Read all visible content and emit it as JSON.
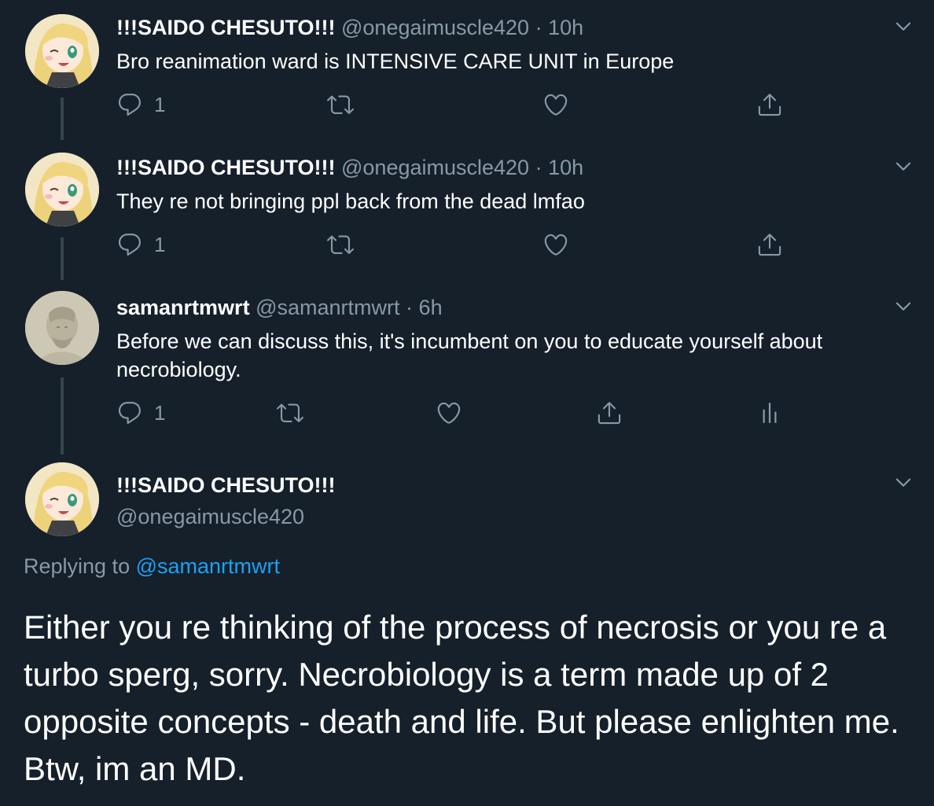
{
  "tweets": [
    {
      "name": "!!!SAIDO CHESUTO!!!",
      "handle": "@onegaimuscle420",
      "separator": "·",
      "time": "10h",
      "text": "Bro reanimation ward is INTENSIVE CARE UNIT in Europe",
      "reply_count": "1"
    },
    {
      "name": "!!!SAIDO CHESUTO!!!",
      "handle": "@onegaimuscle420",
      "separator": "·",
      "time": "10h",
      "text": "They re not bringing ppl back from the dead lmfao",
      "reply_count": "1"
    },
    {
      "name": "samanrtmwrt",
      "handle": "@samanrtmwrt",
      "separator": "·",
      "time": "6h",
      "text_line1": "Before we can discuss this, it's incumbent on you to educate yourself about",
      "text_line2": "necrobiology.",
      "reply_count": "1"
    }
  ],
  "main_tweet": {
    "name": "!!!SAIDO CHESUTO!!!",
    "handle": "@onegaimuscle420",
    "replying_prefix": "Replying to",
    "replying_handle": "@samanrtmwrt",
    "text": "Either you re thinking of the process of necrosis or you re a turbo sperg, sorry. Necrobiology is a term made up of 2 opposite concepts - death and life. But please enlighten me. Btw, im an MD."
  },
  "colors": {
    "background": "#15202b",
    "secondary_text": "#8899a6",
    "link": "#1da1f2",
    "thread_line": "#38444d"
  },
  "icons": [
    "reply-icon",
    "retweet-icon",
    "like-icon",
    "share-icon",
    "analytics-icon",
    "chevron-down-icon"
  ]
}
